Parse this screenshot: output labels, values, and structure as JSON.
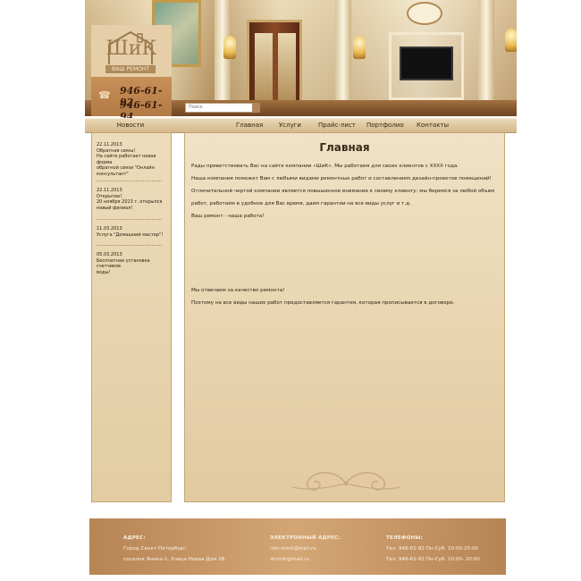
{
  "brand": {
    "logo_text": "ШиК",
    "tagline": "ВАШ РЕМОНТ",
    "phones": [
      "946-61-92",
      "946-61-94"
    ]
  },
  "search": {
    "placeholder": "Поиск"
  },
  "nav": {
    "news": "Новости",
    "items": [
      "Главная",
      "Услуги",
      "Прайс-лист",
      "Портфолио",
      "Контакты"
    ]
  },
  "news": [
    {
      "date": "22.11.2013",
      "lines": [
        "Обратная связь!",
        "На сайте работает новая форма",
        "обратной связи \"Онлайн",
        "консультант\""
      ]
    },
    {
      "date": "22.11.2013",
      "lines": [
        "Открытие!",
        "20 ноября 2013 г. открылся",
        "новый филиал!"
      ]
    },
    {
      "date": "11.03.2013",
      "lines": [
        "Услуга \"Домашний мастер\"!"
      ]
    },
    {
      "date": "05.03.2013",
      "lines": [
        "Бесплатная установка счетчиков",
        "воды!"
      ]
    }
  ],
  "main": {
    "title": "Главная",
    "paragraphs": [
      "Рады приветствовать Вас на сайте компании «ШиК». Мы работаем для своих клиентов с XXXX года.",
      "Наша компания поможет Вам с любыми видами ремонтных работ и составлением дизайн-проектов помещений!",
      "Отличительной чертой компании является повышенное внимание к своему клиенту: мы беремся за любой объем",
      "работ, работаем в удобное для Вас время, даем гарантии на все виды услуг и т.д.",
      "Ваш ремонт - наша работа!",
      "Мы отвечаем за качество ремонта!",
      "Поэтому на все виды наших работ предоставляется гарантия, которая прописывается в договоре."
    ]
  },
  "footer": {
    "address": {
      "heading": "АДРЕС:",
      "lines": [
        "Город Санкт-Петербург,",
        "поселок Янино-1, Улица Новая Дом 2Б."
      ]
    },
    "email": {
      "heading": "ЭЛЕКТРОННЫЙ АДРЕС:",
      "lines": [
        "info.shick@mail.ru",
        "strshik@mail.ru"
      ]
    },
    "phones": {
      "heading": "ТЕЛЕФОНЫ:",
      "lines": [
        "Тел. 946-61-92 Пн-Суб. 10:00-20:00",
        "Тел. 946-61-92 Пн-Суб. 10:00- 20:00"
      ]
    }
  },
  "colors": {
    "accent": "#b27a44",
    "panel": "#e6cfa8",
    "footer": "#c79a6a",
    "text": "#3b2a1a"
  }
}
